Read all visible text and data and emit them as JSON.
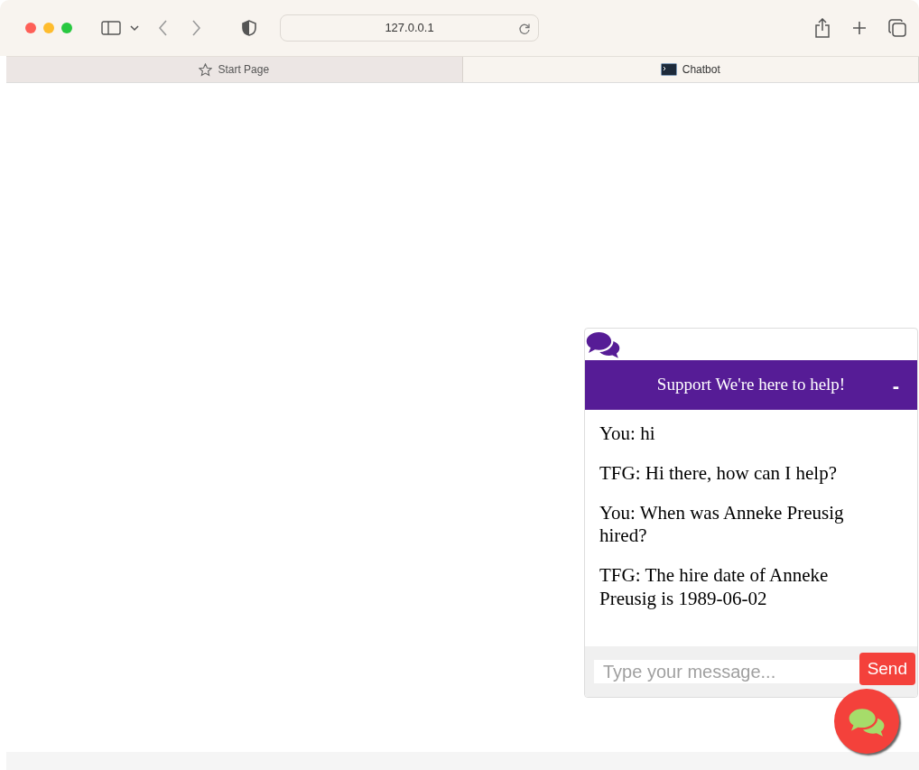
{
  "browser": {
    "url": "127.0.0.1",
    "tabs": [
      {
        "label": "Start Page",
        "kind": "start",
        "selected": false
      },
      {
        "label": "Chatbot",
        "kind": "site",
        "selected": true
      }
    ]
  },
  "chat": {
    "title": "Support We're here to help!",
    "minimize": "-",
    "messages": [
      {
        "text": "You: hi"
      },
      {
        "text": "TFG: Hi there, how can I help?"
      },
      {
        "text": "You: When was Anneke Preusig hired?"
      },
      {
        "text": "TFG: The hire date of Anneke Preusig is 1989-06-02"
      }
    ],
    "input": {
      "placeholder": "Type your message..."
    },
    "send": "Send"
  }
}
